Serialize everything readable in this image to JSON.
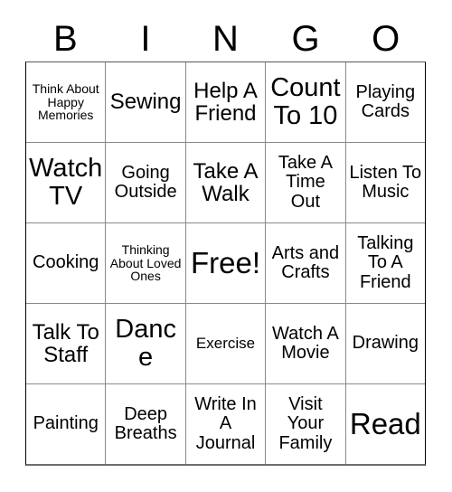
{
  "card": {
    "title": "Bingo Card",
    "header_letters": [
      "B",
      "I",
      "N",
      "G",
      "O"
    ],
    "free_space_label": "Free!",
    "colors": {
      "background": "#ffffff",
      "text": "#000000",
      "grid_line": "#8a8a8c",
      "grid_outer": "#000000"
    },
    "rows": [
      [
        {
          "text": "Think About Happy Memories",
          "size": "s-xs"
        },
        {
          "text": "Sewing",
          "size": "s-lg"
        },
        {
          "text": "Help A Friend",
          "size": "s-lg"
        },
        {
          "text": "Count To 10",
          "size": "s-xl"
        },
        {
          "text": "Playing Cards",
          "size": "s-md"
        }
      ],
      [
        {
          "text": "Watch TV",
          "size": "s-xl"
        },
        {
          "text": "Going Outside",
          "size": "s-md"
        },
        {
          "text": "Take A Walk",
          "size": "s-lg"
        },
        {
          "text": "Take A Time Out",
          "size": "s-md"
        },
        {
          "text": "Listen To Music",
          "size": "s-md"
        }
      ],
      [
        {
          "text": "Cooking",
          "size": "s-md"
        },
        {
          "text": "Thinking About Loved Ones",
          "size": "s-xs"
        },
        {
          "text": "Free!",
          "size": "s-xxl"
        },
        {
          "text": "Arts and Crafts",
          "size": "s-md"
        },
        {
          "text": "Talking To A Friend",
          "size": "s-md"
        }
      ],
      [
        {
          "text": "Talk To Staff",
          "size": "s-lg"
        },
        {
          "text": "Dance",
          "size": "s-xl"
        },
        {
          "text": "Exercise",
          "size": "s-sm"
        },
        {
          "text": "Watch A Movie",
          "size": "s-md"
        },
        {
          "text": "Drawing",
          "size": "s-md"
        }
      ],
      [
        {
          "text": "Painting",
          "size": "s-md"
        },
        {
          "text": "Deep Breaths",
          "size": "s-md"
        },
        {
          "text": "Write In A Journal",
          "size": "s-md"
        },
        {
          "text": "Visit Your Family",
          "size": "s-md"
        },
        {
          "text": "Read",
          "size": "s-xxl"
        }
      ]
    ]
  }
}
